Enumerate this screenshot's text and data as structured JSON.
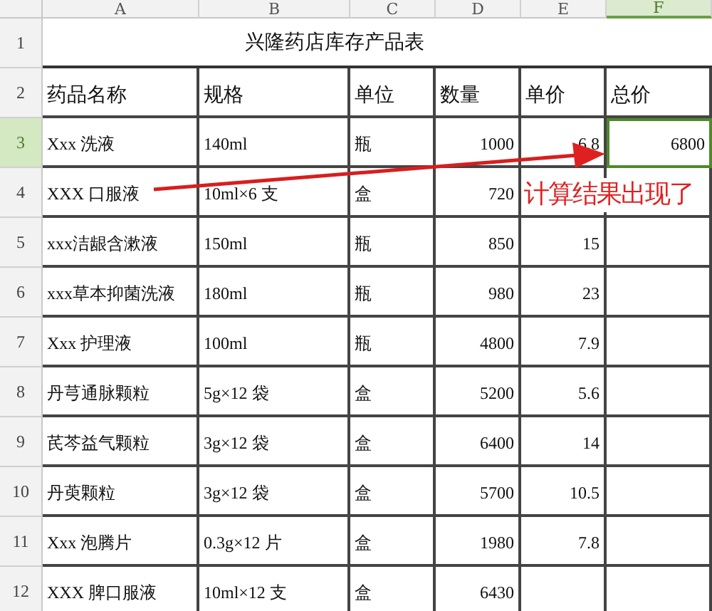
{
  "columns": [
    {
      "label": "A",
      "kind": "text",
      "selected": false
    },
    {
      "label": "B",
      "kind": "text",
      "selected": false
    },
    {
      "label": "C",
      "kind": "text",
      "selected": false
    },
    {
      "label": "D",
      "kind": "number",
      "selected": false
    },
    {
      "label": "E",
      "kind": "number",
      "selected": false
    },
    {
      "label": "F",
      "kind": "number",
      "selected": true
    }
  ],
  "title_row": {
    "number": "1",
    "title": "兴隆药店库存产品表"
  },
  "rows": [
    {
      "number": "2",
      "selected": false,
      "cells": [
        "药品名称",
        "规格",
        "单位",
        "数量",
        "单价",
        "总价"
      ],
      "kind": "header"
    },
    {
      "number": "3",
      "selected": true,
      "cells": [
        "Xxx 洗液",
        "140ml",
        "瓶",
        "1000",
        "6.8",
        "6800"
      ],
      "kind": "data"
    },
    {
      "number": "4",
      "selected": false,
      "cells": [
        "XXX 口服液",
        "10ml×6 支",
        "盒",
        "720"
      ],
      "kind": "data"
    },
    {
      "number": "5",
      "selected": false,
      "cells": [
        "xxx洁龈含漱液",
        "150ml",
        "瓶",
        "850",
        "15"
      ],
      "kind": "data"
    },
    {
      "number": "6",
      "selected": false,
      "cells": [
        "xxx草本抑菌洗液",
        "180ml",
        "瓶",
        "980",
        "23"
      ],
      "kind": "data"
    },
    {
      "number": "7",
      "selected": false,
      "cells": [
        "Xxx 护理液",
        "100ml",
        "瓶",
        "4800",
        "7.9"
      ],
      "kind": "data"
    },
    {
      "number": "8",
      "selected": false,
      "cells": [
        "丹芎通脉颗粒",
        "5g×12 袋",
        "盒",
        "5200",
        "5.6"
      ],
      "kind": "data"
    },
    {
      "number": "9",
      "selected": false,
      "cells": [
        "芪芩益气颗粒",
        "3g×12 袋",
        "盒",
        "6400",
        "14"
      ],
      "kind": "data"
    },
    {
      "number": "10",
      "selected": false,
      "cells": [
        "丹萸颗粒",
        "3g×12 袋",
        "盒",
        "5700",
        "10.5"
      ],
      "kind": "data"
    },
    {
      "number": "11",
      "selected": false,
      "cells": [
        "Xxx 泡腾片",
        "0.3g×12 片",
        "盒",
        "1980",
        "7.8"
      ],
      "kind": "data"
    },
    {
      "number": "12",
      "selected": false,
      "cells": [
        "XXX 脾口服液",
        "10ml×12 支",
        "盒",
        "6430"
      ],
      "kind": "data"
    }
  ],
  "annotation": {
    "text": "计算结果出现了"
  }
}
